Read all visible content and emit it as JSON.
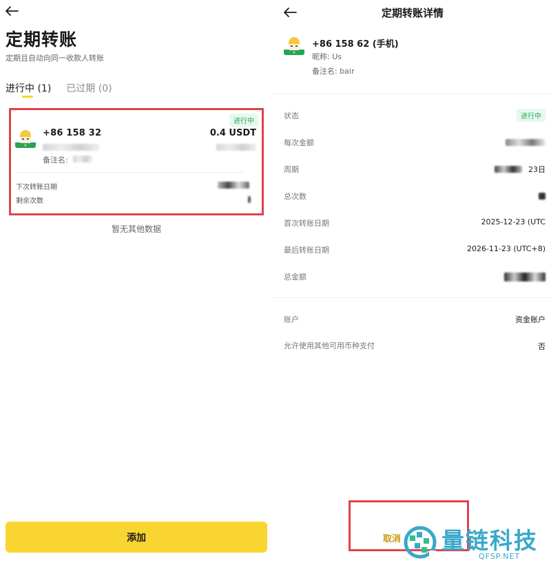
{
  "left": {
    "title": "定期转账",
    "subtitle": "定期且自动向同一收款人转账",
    "tabs": [
      {
        "label": "进行中 (1)",
        "active": true
      },
      {
        "label": "已过期 (0)",
        "active": false
      }
    ],
    "card": {
      "status": "进行中",
      "phone": "+86 158 32",
      "amount": "0.4 USDT",
      "remark": "备注名:",
      "next_date_label": "下次转账日期",
      "remaining_label": "剩余次数"
    },
    "no_data": "暂无其他数据",
    "add_button": "添加"
  },
  "right": {
    "title": "定期转账详情",
    "phone": "+86 158 62 (手机)",
    "nickname": "昵称: Us",
    "remark": "备注名: bair",
    "rows": [
      {
        "label": "状态",
        "value": "进行中"
      },
      {
        "label": "每次金额",
        "value": ""
      },
      {
        "label": "周期",
        "value": "23日"
      },
      {
        "label": "总次数",
        "value": ""
      },
      {
        "label": "首次转账日期",
        "value": "2025-12-23 (UTC"
      },
      {
        "label": "最后转账日期",
        "value": "2026-11-23 (UTC+8)"
      },
      {
        "label": "总金额",
        "value": ""
      }
    ],
    "rows2": [
      {
        "label": "账户",
        "value": "资金账户"
      },
      {
        "label": "允许使用其他可用币种支付",
        "value": "否"
      }
    ],
    "cancel": "取消"
  },
  "watermark": {
    "name": "量链科技",
    "domain": "QFSP.NET"
  },
  "colors": {
    "accent": "#f9d531",
    "status_green": "#28a85a",
    "highlight_red": "#e0424a",
    "watermark": "#3aa8c8"
  }
}
